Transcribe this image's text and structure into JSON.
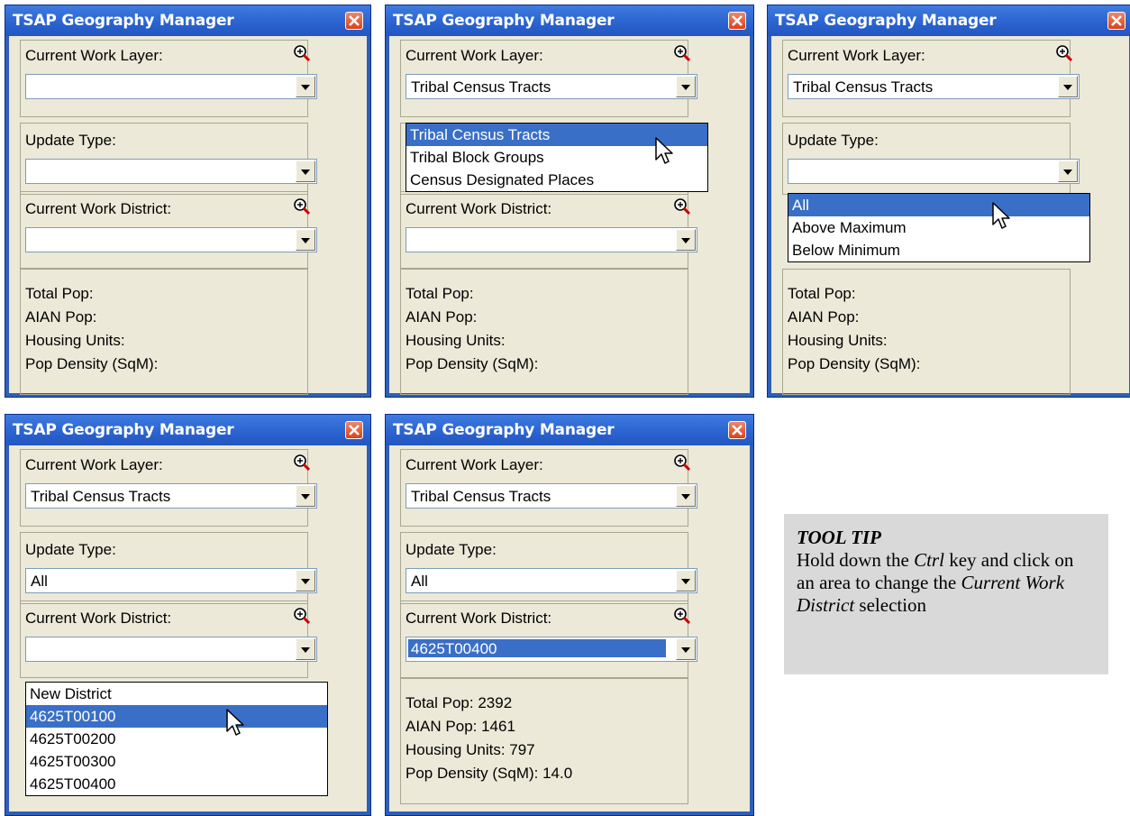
{
  "window_title": "TSAP Geography Manager",
  "labels": {
    "work_layer": "Current Work Layer:",
    "update_type": "Update Type:",
    "work_district": "Current Work District:",
    "total_pop": "Total Pop:",
    "aian_pop": "AIAN Pop:",
    "housing_units": "Housing Units:",
    "pop_density": "Pop Density (SqM):"
  },
  "panels": [
    {
      "work_layer": "",
      "update_type": "",
      "work_district": ""
    },
    {
      "work_layer": "Tribal Census Tracts",
      "update_type": "",
      "work_district": "",
      "dropdown_options": [
        "Tribal Census Tracts",
        "Tribal Block Groups",
        "Census Designated Places"
      ],
      "highlighted": "Tribal Census Tracts"
    },
    {
      "work_layer": "Tribal Census Tracts",
      "update_type": "",
      "work_district": "",
      "dropdown_options": [
        "All",
        "Above Maximum",
        "Below Minimum"
      ],
      "highlighted": "All"
    },
    {
      "work_layer": "Tribal Census Tracts",
      "update_type": "All",
      "work_district": "",
      "dropdown_options": [
        "New District",
        "4625T00100",
        "4625T00200",
        "4625T00300",
        "4625T00400"
      ],
      "highlighted": "4625T00100"
    },
    {
      "work_layer": "Tribal Census Tracts",
      "update_type": "All",
      "work_district": "4625T00400",
      "stats": {
        "total_pop": "Total Pop: 2392",
        "aian_pop": "AIAN Pop: 1461",
        "housing_units": "Housing Units:  797",
        "pop_density": "Pop Density (SqM): 14.0"
      }
    }
  ],
  "tooltip": {
    "title": "TOOL TIP",
    "line1_pre": "Hold down the ",
    "line1_em": "Ctrl",
    "line1_post": " key and click on an area to change the",
    "line2_em": "Current Work District",
    "line3": "selection"
  },
  "icons": [
    "zoom-icon",
    "close-icon",
    "pointer-cursor-icon",
    "dropdown-arrow-icon"
  ]
}
